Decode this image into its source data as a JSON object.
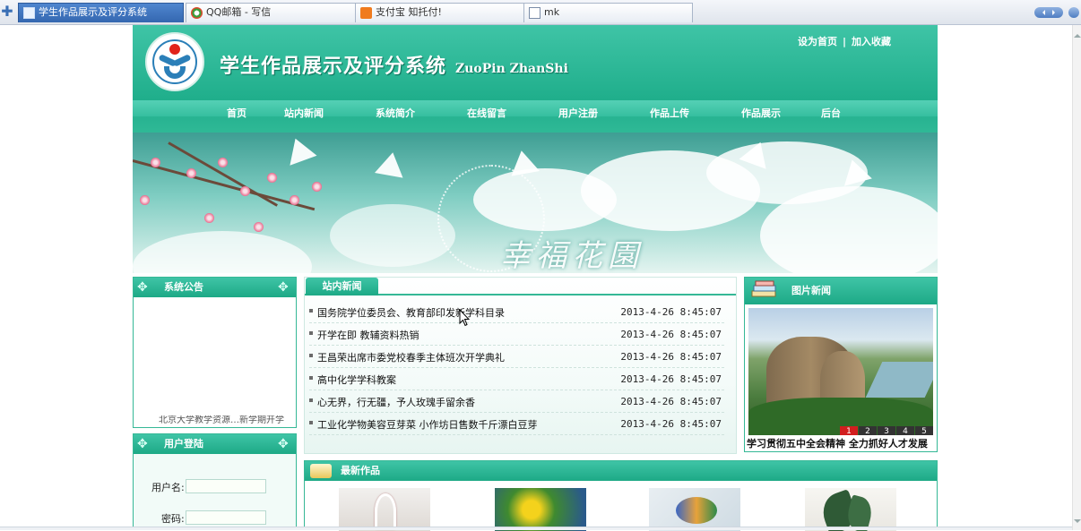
{
  "browser": {
    "tabs": [
      {
        "label": "学生作品展示及评分系统",
        "icon": "doc-icon",
        "active": true
      },
      {
        "label": "QQ邮箱 - 写信",
        "icon": "qq-icon",
        "active": false
      },
      {
        "label": "支付宝 知托付!",
        "icon": "alipay-icon",
        "active": false
      },
      {
        "label": "mk",
        "icon": "doc-icon",
        "active": false
      }
    ]
  },
  "header": {
    "title": "学生作品展示及评分系统",
    "subtitle": "ZuoPin ZhanShi",
    "links": {
      "home": "设为首页",
      "separator": "|",
      "favorite": "加入收藏"
    }
  },
  "nav": [
    "首页",
    "站内新闻",
    "系统简介",
    "在线留言",
    "用户注册",
    "作品上传",
    "作品展示",
    "后台"
  ],
  "banner": {
    "text": "幸福花園"
  },
  "notice": {
    "title": "系统公告",
    "scroll_text": "北京大学教学资源…新学期开学"
  },
  "login": {
    "title": "用户登陆",
    "username_label": "用户名:",
    "password_label": "密码:",
    "username_value": "",
    "password_value": ""
  },
  "news": {
    "title": "站内新闻",
    "items": [
      {
        "title": "国务院学位委员会、教育部印发新学科目录",
        "date": "2013-4-26 8:45:07"
      },
      {
        "title": "开学在即 教辅资料热销",
        "date": "2013-4-26 8:45:07"
      },
      {
        "title": "王昌荣出席市委党校春季主体班次开学典礼",
        "date": "2013-4-26 8:45:07"
      },
      {
        "title": "高中化学学科教案",
        "date": "2013-4-26 8:45:07"
      },
      {
        "title": "心无界，行无疆，予人玫瑰手留余香",
        "date": "2013-4-26 8:45:07"
      },
      {
        "title": "工业化学物美容豆芽菜 小作坊日售数千斤漂白豆芽",
        "date": "2013-4-26 8:45:07"
      }
    ]
  },
  "pic_news": {
    "title": "图片新闻",
    "caption": "学习贯彻五中全会精神 全力抓好人才发展",
    "pages": [
      "1",
      "2",
      "3",
      "4",
      "5"
    ],
    "current_page": 1
  },
  "works": {
    "title": "最新作品"
  }
}
